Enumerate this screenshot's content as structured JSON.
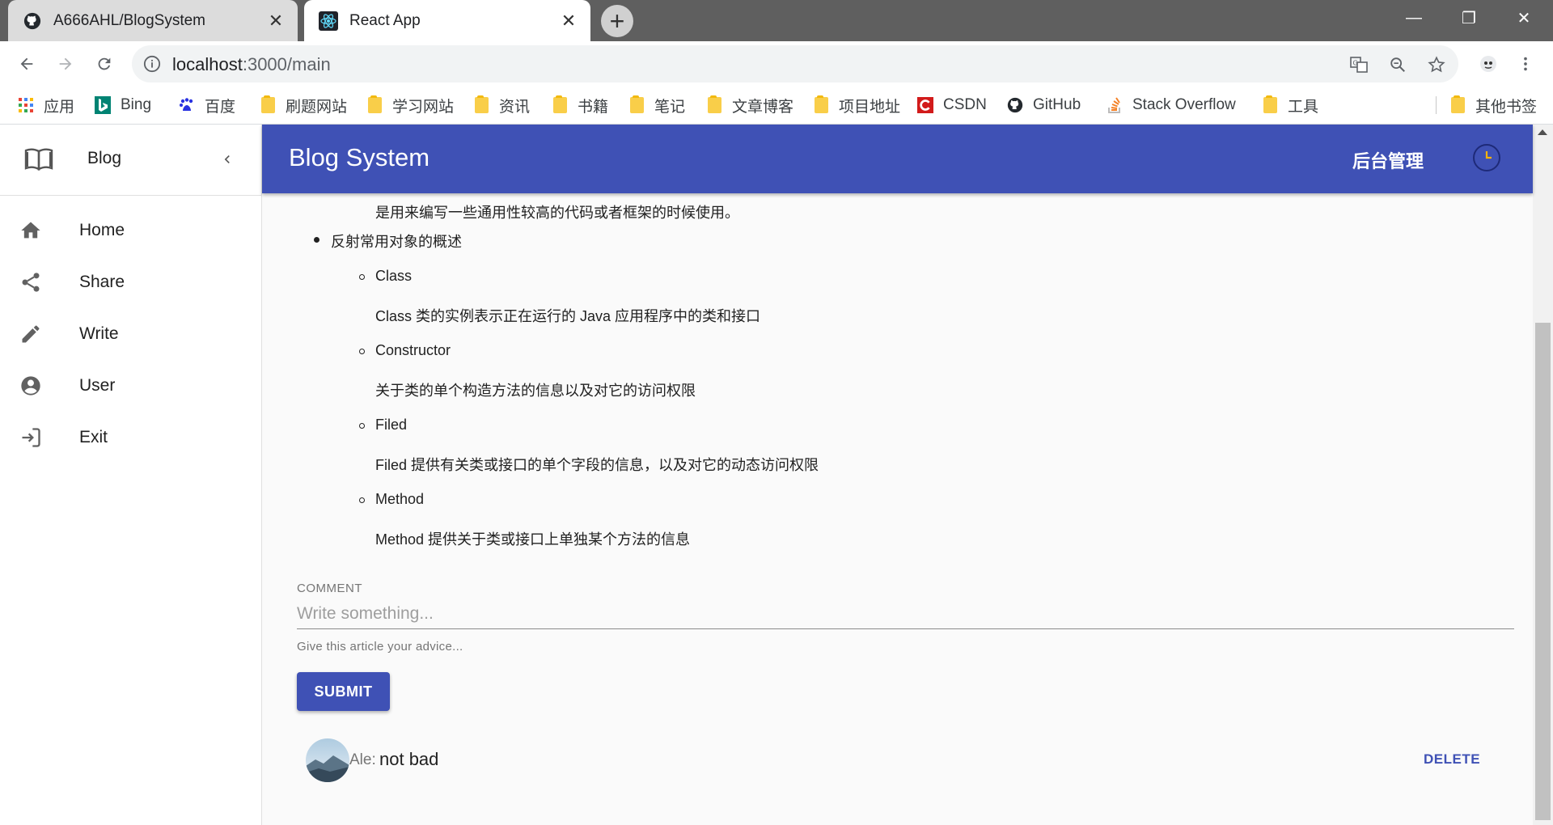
{
  "browser": {
    "tabs": [
      {
        "title": "A666AHL/BlogSystem",
        "icon": "github-icon"
      },
      {
        "title": "React App",
        "icon": "react-icon"
      }
    ],
    "new_tab": "+",
    "window_controls": {
      "minimize": "—",
      "restore": "❐",
      "close": "✕"
    },
    "url_host": "localhost",
    "url_path": ":3000/main",
    "bookmarks": [
      {
        "label": "应用",
        "icon": "apps-grid-icon"
      },
      {
        "label": "Bing",
        "icon": "bing-icon"
      },
      {
        "label": "百度",
        "icon": "baidu-icon"
      },
      {
        "label": "刷题网站",
        "icon": "folder-icon"
      },
      {
        "label": "学习网站",
        "icon": "folder-icon"
      },
      {
        "label": "资讯",
        "icon": "folder-icon"
      },
      {
        "label": "书籍",
        "icon": "folder-icon"
      },
      {
        "label": "笔记",
        "icon": "folder-icon"
      },
      {
        "label": "文章博客",
        "icon": "folder-icon"
      },
      {
        "label": "项目地址",
        "icon": "folder-icon"
      },
      {
        "label": "CSDN",
        "icon": "csdn-icon"
      },
      {
        "label": "GitHub",
        "icon": "github-icon"
      },
      {
        "label": "Stack Overflow",
        "icon": "stackoverflow-icon"
      },
      {
        "label": "工具",
        "icon": "folder-icon"
      },
      {
        "label": "其他书签",
        "icon": "folder-icon"
      }
    ]
  },
  "drawer": {
    "title": "Blog",
    "items": [
      {
        "label": "Home",
        "icon": "home-icon"
      },
      {
        "label": "Share",
        "icon": "share-icon"
      },
      {
        "label": "Write",
        "icon": "pencil-icon"
      },
      {
        "label": "User",
        "icon": "account-circle-icon"
      },
      {
        "label": "Exit",
        "icon": "exit-icon"
      }
    ]
  },
  "appbar": {
    "title": "Blog System",
    "admin_label": "后台管理"
  },
  "article": {
    "intro_tail": "是用来编写一些通用性较高的代码或者框架的时候使用。",
    "section_title": "反射常用对象的概述",
    "items": [
      {
        "name": "Class",
        "desc": "Class 类的实例表示正在运行的 Java 应用程序中的类和接口"
      },
      {
        "name": "Constructor",
        "desc": "关于类的单个构造方法的信息以及对它的访问权限"
      },
      {
        "name": "Filed",
        "desc": "Filed 提供有关类或接口的单个字段的信息，以及对它的动态访问权限"
      },
      {
        "name": "Method",
        "desc": "Method 提供关于类或接口上单独某个方法的信息"
      }
    ]
  },
  "comment_form": {
    "label": "COMMENT",
    "placeholder": "Write something...",
    "value": "",
    "helper": "Give this article your advice...",
    "submit_label": "SUBMIT"
  },
  "comments": [
    {
      "author": "Ale:",
      "text": "not bad",
      "delete_label": "DELETE"
    }
  ]
}
